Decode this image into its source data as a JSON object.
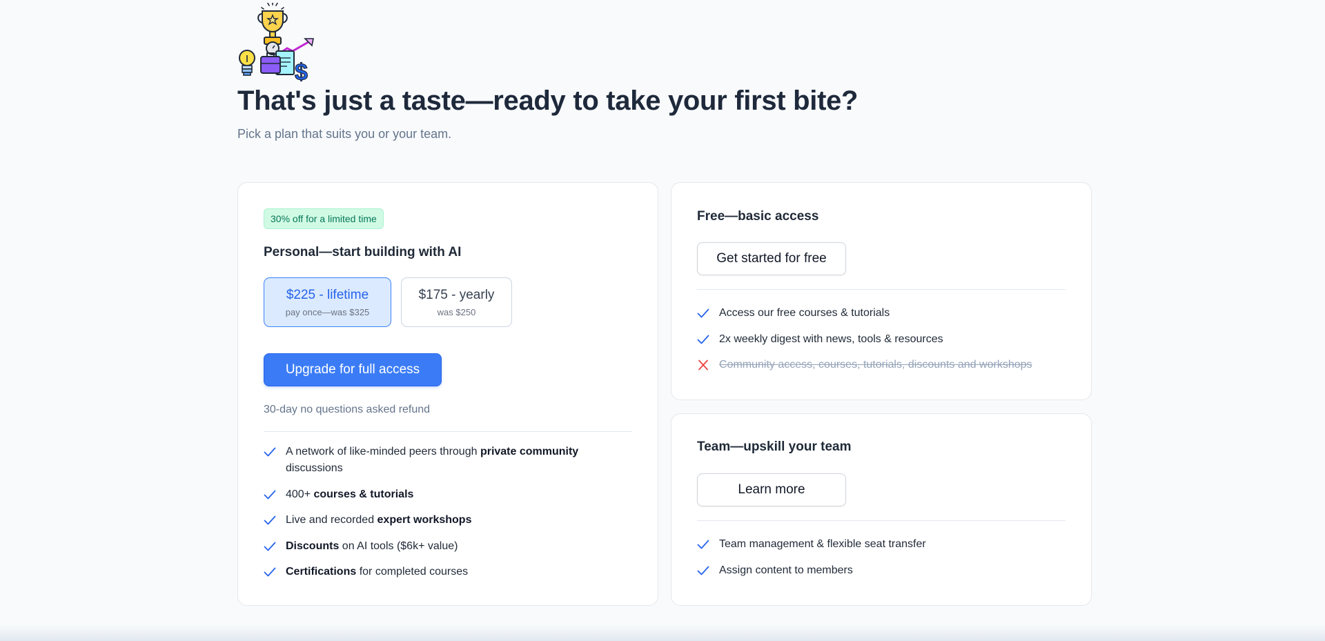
{
  "hero": {
    "headline": "That's just a taste—ready to take your first bite?",
    "subheadline": "Pick a plan that suits you or your team."
  },
  "personal": {
    "badge": "30% off for a limited time",
    "title": "Personal—start building with AI",
    "price_options": [
      {
        "price": "$225 - lifetime",
        "note": "pay once—was $325",
        "selected": true
      },
      {
        "price": "$175 - yearly",
        "note": "was $250",
        "selected": false
      }
    ],
    "cta_label": "Upgrade for full access",
    "refund_note": "30-day no questions asked refund",
    "features": [
      {
        "pre": "A network of like-minded peers through ",
        "bold": "private community",
        "post": " discussions"
      },
      {
        "pre": "400+ ",
        "bold": "courses & tutorials",
        "post": ""
      },
      {
        "pre": "Live and recorded ",
        "bold": "expert workshops",
        "post": ""
      },
      {
        "pre": "",
        "bold": "Discounts",
        "post": " on AI tools ($6k+ value)"
      },
      {
        "pre": "",
        "bold": "Certifications",
        "post": " for completed courses"
      }
    ]
  },
  "free": {
    "title": "Free—basic access",
    "cta_label": "Get started for free",
    "features": [
      {
        "text": "Access our free courses & tutorials",
        "included": true
      },
      {
        "text": "2x weekly digest with news, tools & resources",
        "included": true
      },
      {
        "text": "Community access, courses, tutorials, discounts and workshops",
        "included": false
      }
    ]
  },
  "team": {
    "title": "Team—upskill your team",
    "cta_label": "Learn more",
    "features": [
      {
        "text": "Team management & flexible seat transfer",
        "included": true
      },
      {
        "text": "Assign content to members",
        "included": true
      }
    ]
  },
  "icons": {
    "check": "check-icon",
    "cross": "x-icon",
    "hero": "trophy-growth-illustration"
  },
  "colors": {
    "accent": "#3b7cf6",
    "badge_bg": "#d1fae5",
    "badge_text": "#047857",
    "check": "#2563eb",
    "cross": "#ef4444"
  }
}
